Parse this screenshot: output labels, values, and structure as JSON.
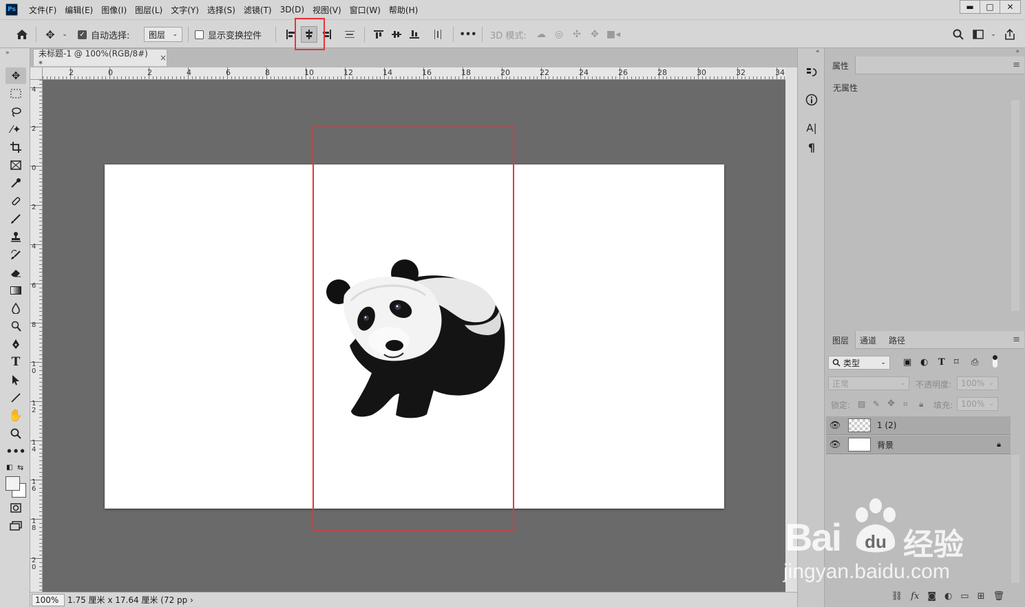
{
  "app": {
    "logo_text": "Ps"
  },
  "menu": [
    "文件(F)",
    "编辑(E)",
    "图像(I)",
    "图层(L)",
    "文字(Y)",
    "选择(S)",
    "滤镜(T)",
    "3D(D)",
    "视图(V)",
    "窗口(W)",
    "帮助(H)"
  ],
  "window_controls": {
    "minimize": "▬",
    "maximize": "□",
    "close": "✕"
  },
  "options": {
    "auto_select_label": "自动选择:",
    "auto_select_checked": true,
    "target_value": "图层",
    "show_transform_label": "显示变换控件",
    "show_transform_checked": false,
    "mode_3d_label": "3D 模式:",
    "more": "•••"
  },
  "document": {
    "tab_title": "未标题-1 @ 100%(RGB/8#) *",
    "tab_close": "×",
    "zoom": "100%",
    "status": "1.75 厘米 x 17.64 厘米 (72 pp ›"
  },
  "ruler": {
    "h_labels": [
      "2",
      "0",
      "2",
      "4",
      "6",
      "8",
      "10",
      "12",
      "14",
      "16",
      "18",
      "20",
      "22",
      "24",
      "26",
      "28",
      "30",
      "32",
      "34"
    ],
    "v_labels": [
      "4",
      "2",
      "0",
      "2",
      "4",
      "6",
      "8",
      "10",
      "12",
      "14",
      "16",
      "18",
      "20"
    ]
  },
  "panels": {
    "properties_tab": "属性",
    "properties_empty": "无属性",
    "layers_tabs": [
      "图层",
      "通道",
      "路径"
    ],
    "filter_kind": "类型",
    "blend_mode": "正常",
    "opacity_label": "不透明度:",
    "opacity_value": "100%",
    "lock_label": "锁定:",
    "fill_label": "填充:",
    "fill_value": "100%",
    "layers": [
      {
        "name": "1 (2)",
        "locked": false
      },
      {
        "name": "背景",
        "locked": true
      }
    ]
  },
  "watermark": {
    "brand": "Bai",
    "brand_cn": "经验",
    "url": "jingyan.baidu.com"
  },
  "colors": {
    "highlight": "#e8343a",
    "workspace": "#6a6a6a",
    "ui_bg": "#d6d6d6"
  }
}
